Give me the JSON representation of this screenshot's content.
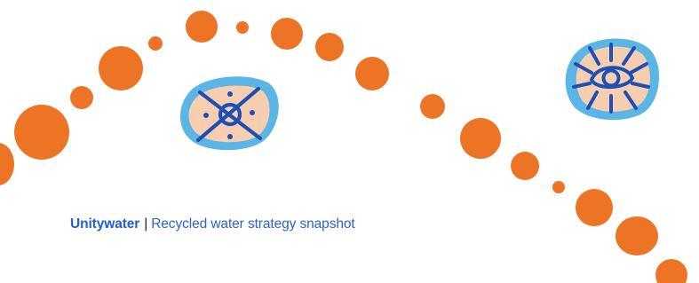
{
  "footer": {
    "brand": "Unitywater",
    "separator": "|",
    "subtitle": "Recycled water strategy snapshot"
  },
  "decoration": {
    "dot_color": "#ee7425",
    "motif_fill": "#f7cfb0",
    "motif_border": "#5bb6e6",
    "motif_line": "#1e4fb5",
    "icons": [
      "crossed-circle-motif-icon",
      "sun-eye-motif-icon"
    ]
  }
}
